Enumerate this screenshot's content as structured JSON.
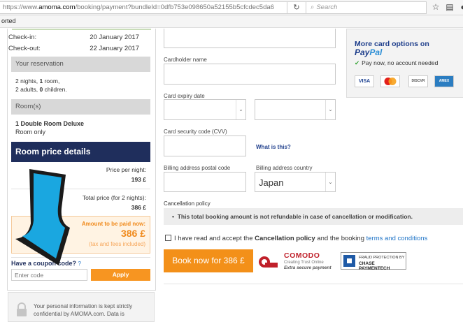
{
  "browser": {
    "url_prefix": "https://www.",
    "url_host": "amoma.com",
    "url_rest": "/booking/payment?bundleId=0dfb753e098650a52155b5cfcdec5da6",
    "search_placeholder": "Search",
    "bookmarks_text": "orted"
  },
  "summary": {
    "checkin_label": "Check-in:",
    "checkin_value": "20 January 2017",
    "checkout_label": "Check-out:",
    "checkout_value": "22 January 2017",
    "reservation_header": "Your reservation",
    "reservation_line1_a": "2 nights, ",
    "reservation_line1_b": "1",
    "reservation_line1_c": " room,",
    "reservation_line2_a": "2 adults, ",
    "reservation_line2_b": "0",
    "reservation_line2_c": " children.",
    "rooms_header": "Room(s)",
    "room_name": "1 Double Room Deluxe",
    "room_board": "Room only",
    "price_details_header": "Room price details",
    "price_per_night_label": "Price per night:",
    "price_per_night_value": "193 £",
    "total_price_label": "Total price (for 2 nights):",
    "total_price_value": "386 £",
    "to_pay_label": "Amount to be paid now:",
    "to_pay_value": "386 £",
    "to_pay_note": "(tax and fees included)",
    "coupon_title": "Have a coupon code?",
    "coupon_help": "?",
    "coupon_placeholder": "Enter code",
    "apply_label": "Apply",
    "privacy_line1": "Your personal information is kept strictly",
    "privacy_line2": "confidential by AMOMA.com. Data is"
  },
  "form": {
    "cardholder_label": "Cardholder name",
    "expiry_label": "Card expiry date",
    "cvv_label": "Card security code (CVV)",
    "what_is_this": "What is this?",
    "postal_label": "Billing address postal code",
    "country_label": "Billing address country",
    "country_value": "Japan",
    "policy_title": "Cancellation policy",
    "policy_text": "This total booking amount is not refundable in case of cancellation or modification.",
    "accept_a": "I have read and accept the ",
    "accept_b": "Cancellation policy",
    "accept_c": " and the booking ",
    "accept_d": "terms and conditions",
    "book_label": "Book now for 386 £"
  },
  "badges": {
    "comodo_name": "COMODO",
    "comodo_sub1": "Creating Trust Online",
    "comodo_sub2": "Extra secure payment",
    "chase_line1": "FRAUD PROTECTION BY",
    "chase_line2": "CHASE PAYMENTECH"
  },
  "card_options": {
    "title": "More card options on",
    "paypal_a": "Pay",
    "paypal_b": "Pal",
    "note": "Pay now, no account needed",
    "cards": [
      "VISA",
      "MC",
      "DISC",
      "AMEX"
    ]
  },
  "colors": {
    "navy": "#1f2e5c",
    "orange": "#f39019",
    "arrow_blue": "#1aa7e0"
  }
}
